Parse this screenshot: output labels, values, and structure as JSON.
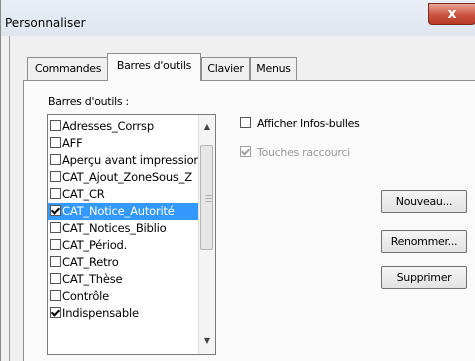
{
  "window": {
    "title": "Personnaliser",
    "close_glyph": "x"
  },
  "tabs": [
    {
      "label": "Commandes",
      "active": false
    },
    {
      "label": "Barres d'outils",
      "active": true
    },
    {
      "label": "Clavier",
      "active": false
    },
    {
      "label": "Menus",
      "active": false
    }
  ],
  "toolbars": {
    "label": "Barres d'outils :",
    "items": [
      {
        "label": "Adresses_Corrsp",
        "checked": false
      },
      {
        "label": "AFF",
        "checked": false
      },
      {
        "label": "Aperçu avant impression",
        "checked": false
      },
      {
        "label": "CAT_Ajout_ZoneSous_Z",
        "checked": false
      },
      {
        "label": "CAT_CR",
        "checked": false
      },
      {
        "label": "CAT_Notice_Autorité",
        "checked": true,
        "selected": true
      },
      {
        "label": "CAT_Notices_Biblio",
        "checked": false
      },
      {
        "label": "CAT_Périod.",
        "checked": false
      },
      {
        "label": "CAT_Retro",
        "checked": false
      },
      {
        "label": "CAT_Thèse",
        "checked": false
      },
      {
        "label": "Contrôle",
        "checked": false
      },
      {
        "label": "Indispensable",
        "checked": true
      }
    ]
  },
  "options": {
    "show_tooltips": {
      "label": "Afficher Infos-bulles",
      "checked": false,
      "enabled": true
    },
    "shortcut_keys": {
      "label": "Touches raccourci",
      "checked": true,
      "enabled": false
    }
  },
  "buttons": {
    "new": "Nouveau...",
    "rename": "Renommer...",
    "delete": "Supprimer"
  },
  "icons": {
    "scroll_up": "scroll-up-arrow-icon",
    "scroll_down": "scroll-down-arrow-icon",
    "close": "close-icon"
  }
}
